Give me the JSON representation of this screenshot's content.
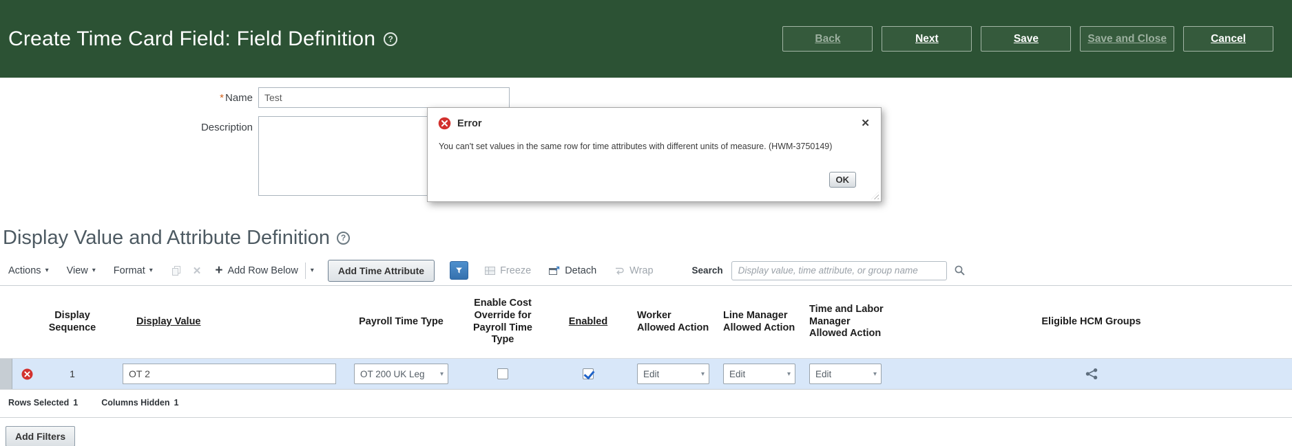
{
  "icons": {
    "help": "?",
    "close": "✕",
    "chevron_down": "▾",
    "plus": "+"
  },
  "header": {
    "title": "Create Time Card Field: Field Definition",
    "buttons": {
      "back": "Back",
      "next": "Next",
      "save": "Save",
      "save_and_close": "Save and Close",
      "cancel": "Cancel"
    }
  },
  "form": {
    "name": {
      "label": "Name",
      "required_marker": "*",
      "value": "Test"
    },
    "description": {
      "label": "Description",
      "value": ""
    }
  },
  "error_dialog": {
    "title": "Error",
    "message": "You can't set values in the same row for time attributes with different units of measure. (HWM-3750149)",
    "ok": "OK"
  },
  "section": {
    "title": "Display Value and Attribute Definition"
  },
  "toolbar": {
    "actions": "Actions",
    "view": "View",
    "format": "Format",
    "add_row_below": "Add Row Below",
    "add_time_attribute": "Add Time Attribute",
    "freeze": "Freeze",
    "detach": "Detach",
    "wrap": "Wrap",
    "search_label": "Search",
    "search_placeholder": "Display value, time attribute, or group name"
  },
  "table": {
    "columns": {
      "display_sequence": "Display Sequence",
      "display_value": "Display Value",
      "payroll_time_type": "Payroll Time Type",
      "enable_cost_override": "Enable Cost Override for Payroll Time Type",
      "enabled": "Enabled",
      "worker_allowed_action": "Worker Allowed Action",
      "line_manager_allowed_action": "Line Manager Allowed Action",
      "time_labor_manager_allowed_action": "Time and Labor Manager Allowed Action",
      "eligible_hcm_groups": "Eligible HCM Groups"
    },
    "rows": [
      {
        "display_sequence": "1",
        "display_value": "OT 2",
        "payroll_time_type": "OT 200 UK Leg",
        "enable_cost_override": false,
        "enabled": true,
        "worker_allowed_action": "Edit",
        "line_manager_allowed_action": "Edit",
        "time_labor_manager_allowed_action": "Edit"
      }
    ],
    "summary": {
      "rows_selected_label": "Rows Selected",
      "rows_selected_value": "1",
      "columns_hidden_label": "Columns Hidden",
      "columns_hidden_value": "1"
    }
  },
  "footer": {
    "add_filters": "Add Filters"
  },
  "colors": {
    "header_green": "#2c5234",
    "selected_row": "#d8e7f9",
    "error_red": "#d2312e",
    "accent_blue": "#3d7fc1"
  }
}
